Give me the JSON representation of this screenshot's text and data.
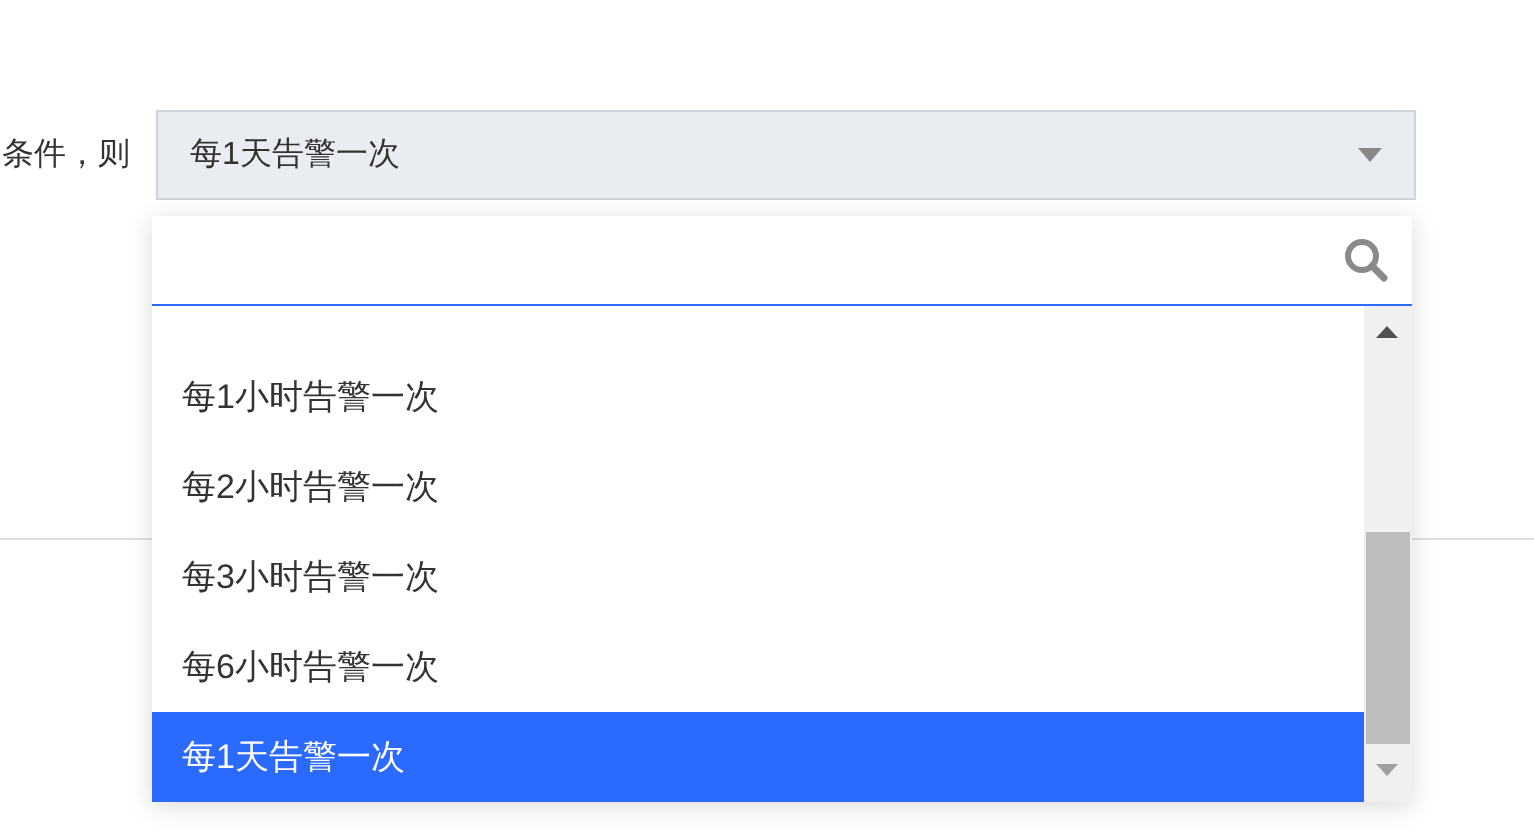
{
  "condition_label": "条件，则",
  "select": {
    "value": "每1天告警一次"
  },
  "dropdown": {
    "options": [
      {
        "label": "每1小时告警一次",
        "selected": false
      },
      {
        "label": "每2小时告警一次",
        "selected": false
      },
      {
        "label": "每3小时告警一次",
        "selected": false
      },
      {
        "label": "每6小时告警一次",
        "selected": false
      },
      {
        "label": "每1天告警一次",
        "selected": true
      }
    ]
  }
}
